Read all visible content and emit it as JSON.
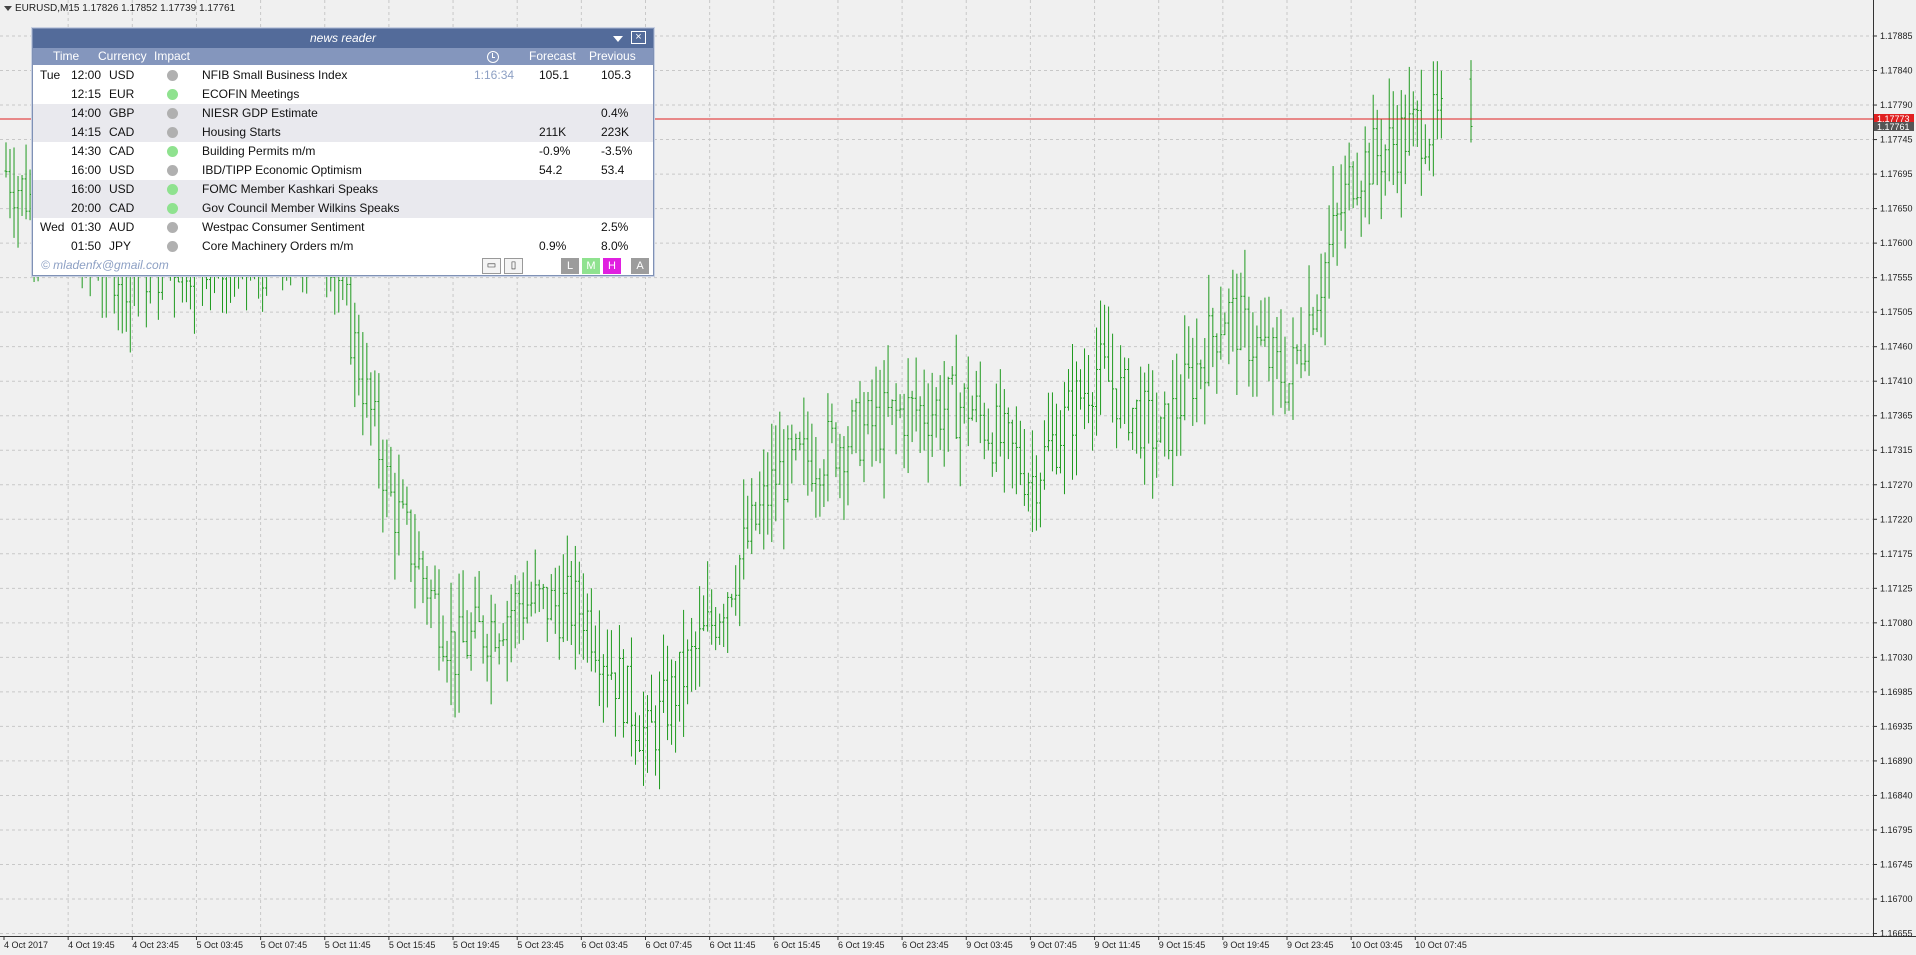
{
  "symbol_header": "EURUSD,M15  1.17826 1.17852 1.17739 1.17761",
  "price_axis": {
    "labels": [
      "1.17885",
      "1.17840",
      "1.17790",
      "1.17745",
      "1.17695",
      "1.17650",
      "1.17600",
      "1.17555",
      "1.17505",
      "1.17460",
      "1.17410",
      "1.17365",
      "1.17315",
      "1.17270",
      "1.17220",
      "1.17175",
      "1.17125",
      "1.17080",
      "1.17030",
      "1.16985",
      "1.16935",
      "1.16890",
      "1.16840",
      "1.16795",
      "1.16745",
      "1.16700",
      "1.16655"
    ],
    "current_ask": "1.17773",
    "current_bid": "1.17761"
  },
  "time_axis": {
    "labels": [
      "4 Oct 2017",
      "4 Oct 19:45",
      "4 Oct 23:45",
      "5 Oct 03:45",
      "5 Oct 07:45",
      "5 Oct 11:45",
      "5 Oct 15:45",
      "5 Oct 19:45",
      "5 Oct 23:45",
      "6 Oct 03:45",
      "6 Oct 07:45",
      "6 Oct 11:45",
      "6 Oct 15:45",
      "6 Oct 19:45",
      "6 Oct 23:45",
      "9 Oct 03:45",
      "9 Oct 07:45",
      "9 Oct 11:45",
      "9 Oct 15:45",
      "9 Oct 19:45",
      "9 Oct 23:45",
      "10 Oct 03:45",
      "10 Oct 07:45"
    ]
  },
  "colors": {
    "bar": "#1f9a1f",
    "bid_line": "#e02020",
    "grid": "#c8c8c8",
    "panel_title_bg": "#536b9a",
    "panel_header_bg": "#8496bd",
    "impact_low": "#b0b0b0",
    "impact_medium": "#8fe28f",
    "btn_L": "#9c9c9c",
    "btn_M": "#8fe28f",
    "btn_H": "#e020e0",
    "btn_A": "#9c9c9c"
  },
  "news_panel": {
    "title": "news reader",
    "close_label": "☒",
    "headers": {
      "time": "Time",
      "currency": "Currency",
      "impact": "Impact",
      "forecast": "Forecast",
      "previous": "Previous"
    },
    "rows": [
      {
        "day": "Tue",
        "time": "12:00",
        "currency": "USD",
        "impact": "gray",
        "event": "NFIB Small Business Index",
        "countdown": "1:16:34",
        "forecast": "105.1",
        "previous": "105.3",
        "shade": false
      },
      {
        "day": "",
        "time": "12:15",
        "currency": "EUR",
        "impact": "green",
        "event": "ECOFIN Meetings",
        "countdown": "",
        "forecast": "",
        "previous": "",
        "shade": false
      },
      {
        "day": "",
        "time": "14:00",
        "currency": "GBP",
        "impact": "gray",
        "event": "NIESR GDP Estimate",
        "countdown": "",
        "forecast": "",
        "previous": "0.4%",
        "shade": true
      },
      {
        "day": "",
        "time": "14:15",
        "currency": "CAD",
        "impact": "gray",
        "event": "Housing Starts",
        "countdown": "",
        "forecast": "211K",
        "previous": "223K",
        "shade": true
      },
      {
        "day": "",
        "time": "14:30",
        "currency": "CAD",
        "impact": "green",
        "event": "Building Permits m/m",
        "countdown": "",
        "forecast": "-0.9%",
        "previous": "-3.5%",
        "shade": false
      },
      {
        "day": "",
        "time": "16:00",
        "currency": "USD",
        "impact": "gray",
        "event": "IBD/TIPP Economic Optimism",
        "countdown": "",
        "forecast": "54.2",
        "previous": "53.4",
        "shade": false
      },
      {
        "day": "",
        "time": "16:00",
        "currency": "USD",
        "impact": "green",
        "event": "FOMC Member Kashkari Speaks",
        "countdown": "",
        "forecast": "",
        "previous": "",
        "shade": true
      },
      {
        "day": "",
        "time": "20:00",
        "currency": "CAD",
        "impact": "green",
        "event": "Gov Council Member Wilkins Speaks",
        "countdown": "",
        "forecast": "",
        "previous": "",
        "shade": true
      },
      {
        "day": "Wed",
        "time": "01:30",
        "currency": "AUD",
        "impact": "gray",
        "event": "Westpac Consumer Sentiment",
        "countdown": "",
        "forecast": "",
        "previous": "2.5%",
        "shade": false
      },
      {
        "day": "",
        "time": "01:50",
        "currency": "JPY",
        "impact": "gray",
        "event": "Core Machinery Orders m/m",
        "countdown": "",
        "forecast": "0.9%",
        "previous": "8.0%",
        "shade": false
      }
    ],
    "footer": {
      "email": "© mladenfx@gmail.com",
      "lock_icon": "🔒",
      "window_icon": "▯",
      "filter_buttons": [
        "L",
        "M",
        "H",
        "A"
      ]
    }
  },
  "chart_data": {
    "type": "ohlc",
    "symbol": "EURUSD",
    "timeframe": "M15",
    "last_bar": {
      "open": 1.17826,
      "high": 1.17852,
      "low": 1.17739,
      "close": 1.17761
    },
    "ylim": [
      1.16655,
      1.1791
    ],
    "approx_close_path": [
      {
        "time": "4 Oct 2017",
        "price": 1.177
      },
      {
        "time": "4 Oct 19:45",
        "price": 1.176
      },
      {
        "time": "4 Oct 23:45",
        "price": 1.1756
      },
      {
        "time": "5 Oct 03:45",
        "price": 1.1759
      },
      {
        "time": "5 Oct 07:45",
        "price": 1.1758
      },
      {
        "time": "5 Oct 11:45",
        "price": 1.1762
      },
      {
        "time": "5 Oct 15:45",
        "price": 1.1725
      },
      {
        "time": "5 Oct 19:45",
        "price": 1.1704
      },
      {
        "time": "5 Oct 23:45",
        "price": 1.1711
      },
      {
        "time": "6 Oct 03:45",
        "price": 1.171
      },
      {
        "time": "6 Oct 07:45",
        "price": 1.1692
      },
      {
        "time": "6 Oct 11:45",
        "price": 1.1708
      },
      {
        "time": "6 Oct 15:45",
        "price": 1.1728
      },
      {
        "time": "6 Oct 19:45",
        "price": 1.1733
      },
      {
        "time": "6 Oct 23:45",
        "price": 1.1737
      },
      {
        "time": "9 Oct 03:45",
        "price": 1.1738
      },
      {
        "time": "9 Oct 07:45",
        "price": 1.1728
      },
      {
        "time": "9 Oct 11:45",
        "price": 1.1743
      },
      {
        "time": "9 Oct 15:45",
        "price": 1.1733
      },
      {
        "time": "9 Oct 19:45",
        "price": 1.1751
      },
      {
        "time": "9 Oct 23:45",
        "price": 1.1741
      },
      {
        "time": "10 Oct 03:45",
        "price": 1.177
      },
      {
        "time": "10 Oct 07:45",
        "price": 1.17761
      }
    ]
  }
}
